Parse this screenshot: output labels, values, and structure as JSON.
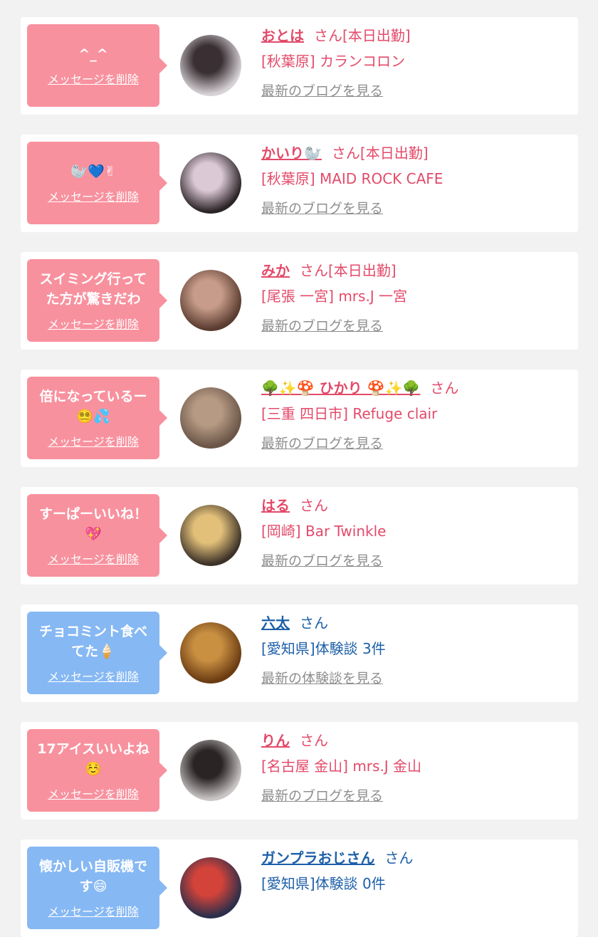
{
  "items": [
    {
      "theme": "pink",
      "message": "^_^",
      "delete_label": "メッセージを削除",
      "name": "おとは",
      "suffix": "さん[本日出勤]",
      "detail": "[秋葉原] カランコロン",
      "link": "最新のブログを見る",
      "avatar_colors": [
        "#d7d2d6",
        "#3a3034"
      ]
    },
    {
      "theme": "pink",
      "message": "🦭💙✌",
      "delete_label": "メッセージを削除",
      "name": "かいり🦭",
      "suffix": "さん[本日出勤]",
      "detail": "[秋葉原] MAID ROCK CAFE",
      "link": "最新のブログを見る",
      "avatar_colors": [
        "#2b2426",
        "#dcc9d6"
      ]
    },
    {
      "theme": "pink",
      "message": "スイミング行ってた方が驚きだわ",
      "delete_label": "メッセージを削除",
      "name": "みか",
      "suffix": "さん[本日出勤]",
      "detail": "[尾張 一宮] mrs.J 一宮",
      "link": "最新のブログを見る",
      "avatar_colors": [
        "#5a3c30",
        "#c89c8a"
      ]
    },
    {
      "theme": "pink",
      "message": "倍になっているー😵‍💫💦",
      "delete_label": "メッセージを削除",
      "name": "🌳✨🍄 ひかり 🍄✨🌳",
      "suffix": "さん",
      "detail": "[三重 四日市] Refuge clair",
      "link": "最新のブログを見る",
      "avatar_colors": [
        "#6a5547",
        "#b69a84"
      ]
    },
    {
      "theme": "pink",
      "message": "すーぱーいいね！💖",
      "delete_label": "メッセージを削除",
      "name": "はる",
      "suffix": "さん",
      "detail": "[岡崎] Bar Twinkle",
      "link": "最新のブログを見る",
      "avatar_colors": [
        "#3d3228",
        "#e2c07a"
      ]
    },
    {
      "theme": "blue",
      "message": "チョコミント食べてた🍦",
      "delete_label": "メッセージを削除",
      "name": "六太",
      "suffix": "さん",
      "detail": "[愛知県]体験談 3件",
      "link": "最新の体験談を見る",
      "avatar_colors": [
        "#6b3c12",
        "#c99042"
      ]
    },
    {
      "theme": "pink",
      "message": "17アイスいいよね☺️",
      "delete_label": "メッセージを削除",
      "name": "りん",
      "suffix": "さん",
      "detail": "[名古屋 金山] mrs.J 金山",
      "link": "最新のブログを見る",
      "avatar_colors": [
        "#c9c5c4",
        "#2a2424"
      ]
    },
    {
      "theme": "blue",
      "message": "懐かしい自販機です😄",
      "delete_label": "メッセージを削除",
      "name": "ガンプラおじさん",
      "suffix": "さん",
      "detail": "[愛知県]体験談 0件",
      "link": "",
      "avatar_colors": [
        "#2c2f4a",
        "#d4433a"
      ]
    }
  ]
}
